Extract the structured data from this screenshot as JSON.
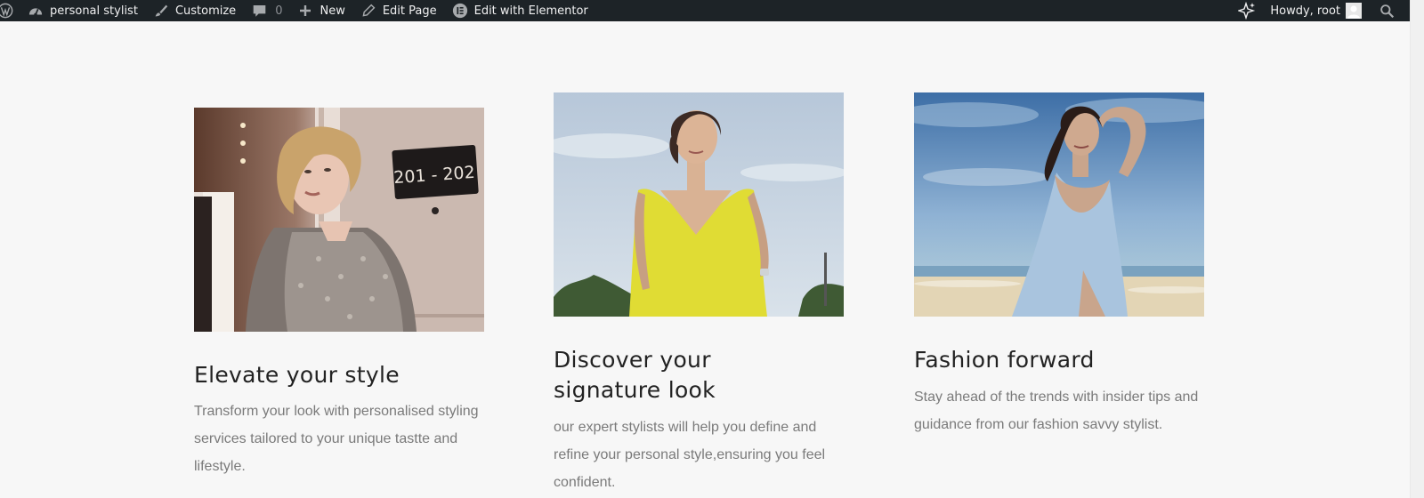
{
  "adminbar": {
    "site_name": "personal stylist",
    "customize": "Customize",
    "comments_count": "0",
    "new": "New",
    "edit_page": "Edit Page",
    "edit_elementor": "Edit with Elementor",
    "howdy": "Howdy, root",
    "icons": [
      "wordpress-icon",
      "dashboard-icon",
      "brush-icon",
      "comment-icon",
      "plus-icon",
      "pencil-icon",
      "elementor-icon",
      "sparkle-icon",
      "avatar",
      "search-icon"
    ]
  },
  "cards": [
    {
      "title": "Elevate your style",
      "text": "Transform your look with personalised styling services tailored to your unique tastte and lifestyle.",
      "image": "woman in sequin jacket by door 201-202",
      "door_sign": "201 - 202"
    },
    {
      "title": "Discover your signature look",
      "text": "our expert stylists will help you define and refine your personal style,ensuring you feel confident.",
      "image": "woman in yellow dress outdoors"
    },
    {
      "title": "Fashion forward",
      "text": "Stay ahead of the trends with insider tips and guidance from our fashion savvy stylist.",
      "image": "woman in light blue dress on beach"
    }
  ],
  "colors": {
    "adminbar_bg": "#1d2327",
    "page_bg": "#f7f7f7",
    "title": "#222222",
    "body_text": "#7a7a7a"
  }
}
